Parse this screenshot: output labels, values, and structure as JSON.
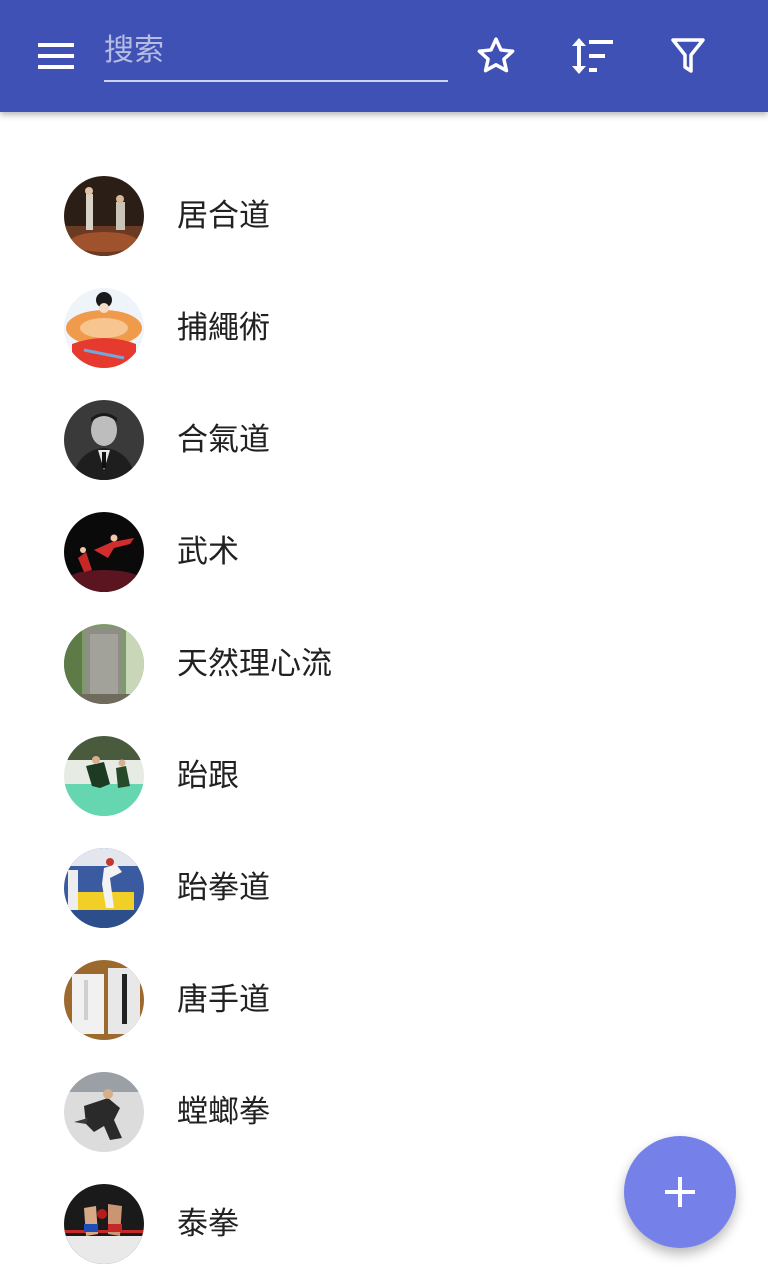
{
  "toolbar": {
    "menu_icon": "menu-icon",
    "search": {
      "placeholder": "搜索",
      "value": ""
    },
    "actions": [
      {
        "icon": "star-outline-icon"
      },
      {
        "icon": "sort-icon"
      },
      {
        "icon": "filter-icon"
      }
    ]
  },
  "colors": {
    "toolbar": "#3f51b5",
    "fab": "#7580e8",
    "text": "#212121",
    "background": "#ffffff"
  },
  "list": {
    "items": [
      {
        "label": "居合道",
        "thumb": "iaido-thumbnail"
      },
      {
        "label": "捕繩術",
        "thumb": "hojojutsu-thumbnail"
      },
      {
        "label": "合氣道",
        "thumb": "aikido-thumbnail"
      },
      {
        "label": "武术",
        "thumb": "wushu-thumbnail"
      },
      {
        "label": "天然理心流",
        "thumb": "tennen-rishin-ryu-thumbnail"
      },
      {
        "label": "跆跟",
        "thumb": "taekkyon-thumbnail"
      },
      {
        "label": "跆拳道",
        "thumb": "taekwondo-thumbnail"
      },
      {
        "label": "唐手道",
        "thumb": "tang-soo-do-thumbnail"
      },
      {
        "label": "螳螂拳",
        "thumb": "mantis-boxing-thumbnail"
      },
      {
        "label": "泰拳",
        "thumb": "muay-thai-thumbnail"
      }
    ]
  },
  "fab": {
    "icon": "plus-icon"
  }
}
